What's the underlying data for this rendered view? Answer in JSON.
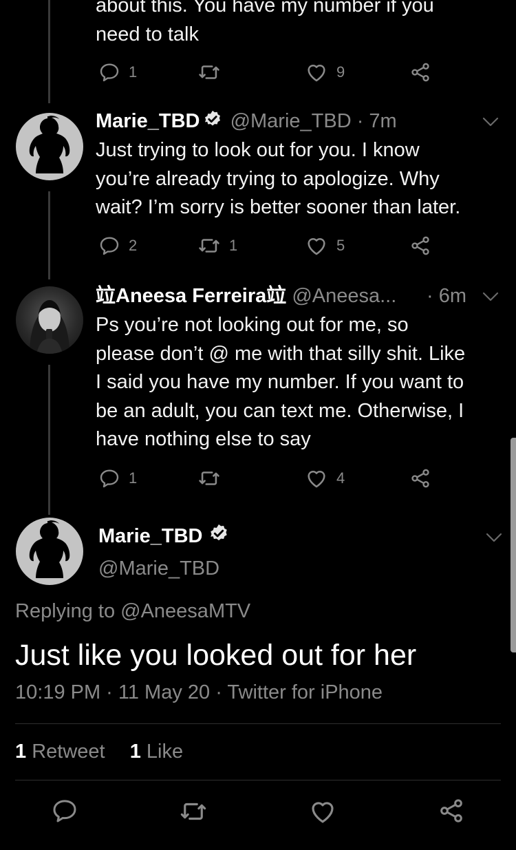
{
  "thread": {
    "partial_tweet": {
      "text": "about this. You have my number if you\nneed to talk",
      "actions": {
        "reply_count": "1",
        "retweet_count": "",
        "like_count": "9"
      }
    },
    "tweet_marie": {
      "name": "Marie_TBD",
      "handle": "@Marie_TBD",
      "time": "· 7m",
      "text": "Just trying to look out for you. I know\nyou’re already trying to apologize. Why\nwait? I’m sorry is better sooner than later.",
      "actions": {
        "reply_count": "2",
        "retweet_count": "1",
        "like_count": "5"
      }
    },
    "tweet_aneesa": {
      "name": "竝Aneesa Ferreira竝",
      "handle": "@Aneesa...",
      "time": "· 6m",
      "text": "Ps you’re not looking out for me, so\nplease don’t @ me with that silly shit. Like\nI said you have my number. If you want to\nbe an adult, you can text me. Otherwise, I\nhave nothing else to say",
      "actions": {
        "reply_count": "1",
        "retweet_count": "",
        "like_count": "4"
      }
    }
  },
  "main_tweet": {
    "name": "Marie_TBD",
    "handle": "@Marie_TBD",
    "replying_to": "Replying to @AneesaMTV",
    "text": "Just like you looked out for her",
    "meta": "10:19 PM · 11 May 20 · Twitter for iPhone",
    "stats": {
      "retweet_count": "1",
      "retweet_label": " Retweet",
      "like_count": "1",
      "like_label": " Like"
    }
  },
  "icons": {
    "reply": "reply-icon",
    "retweet": "retweet-icon",
    "like": "heart-icon",
    "share": "share-icon",
    "caret": "chevron-down-icon",
    "verified": "verified-badge-icon"
  },
  "colors": {
    "background": "#000000",
    "text_primary": "#f2f2f2",
    "text_secondary": "#8a8a8a",
    "divider": "#2f2f2f"
  }
}
